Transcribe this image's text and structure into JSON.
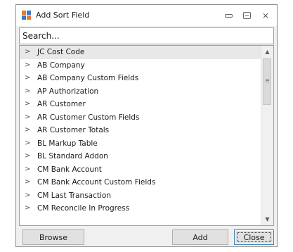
{
  "window": {
    "title": "Add Sort Field"
  },
  "search": {
    "placeholder": "Search..."
  },
  "list": {
    "items": [
      "JC Cost Code",
      "AB Company",
      "AB Company Custom Fields",
      "AP Authorization",
      "AR Customer",
      "AR Customer Custom Fields",
      "AR Customer Totals",
      "BL Markup Table",
      "BL Standard Addon",
      "CM Bank Account",
      "CM Bank Account Custom Fields",
      "CM Last Transaction",
      "CM Reconcile In Progress"
    ],
    "selected": "JC Cost Code"
  },
  "buttons": {
    "browse": "Browse",
    "add": "Add",
    "close": "Close"
  },
  "colors": {
    "icon_orange": "#e8792b",
    "icon_blue": "#3a78c8",
    "selected_row": "#e8e8e8"
  }
}
